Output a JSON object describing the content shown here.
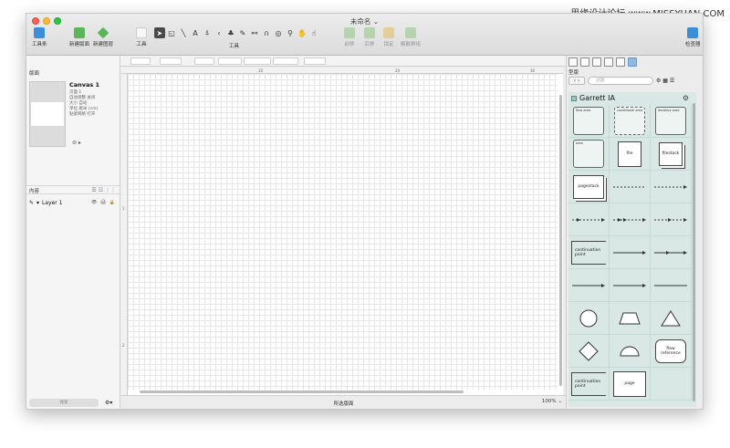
{
  "watermark": "思缘设计论坛  www.MISSYUAN.COM",
  "window": {
    "title": "未命名 ⌄"
  },
  "toolbar": {
    "sidebar_label": "工具条",
    "new_canvas_label": "新建版面",
    "new_layer_label": "新建图层",
    "style_label": "工具",
    "tools_label": "工具",
    "front_label": "前移",
    "back_label": "后移",
    "lock_label": "锁定",
    "ungroup_label": "解散群组",
    "inspector_label": "检查器"
  },
  "left": {
    "canvases_header": "版面",
    "canvas_name": "Canvas 1",
    "canvas_meta": [
      "页面 1",
      "",
      "自动调整 关闭",
      "大小 自动",
      "单位 厘米 (cm)",
      "贴紧网格 打开"
    ],
    "content_header": "内容",
    "layer_name": "Layer 1",
    "layer_icons": "👁 🖨 🔒",
    "search_placeholder": "搜索"
  },
  "ruler": {
    "t10": "10",
    "t20": "20",
    "t30": "30",
    "l1": "1",
    "l2": "2"
  },
  "status": {
    "selection": "所选版面",
    "zoom": "100% ⌄"
  },
  "stencils": {
    "header": "型版",
    "search_placeholder": "过滤",
    "title": "Garrett IA",
    "shapes": {
      "flow_area": "flow area",
      "conditional_area": "conditional area",
      "iterative_area": "iterative area",
      "area": "area",
      "file": "file",
      "filestack": "filestack",
      "pagestack": "pagestack",
      "continuation_point": "continuation point",
      "flow_reference": "flow reference",
      "page": "page"
    }
  },
  "colors": {
    "stencil_bg": "#d9e8e4",
    "selected_tab": "#8fb8e2"
  }
}
